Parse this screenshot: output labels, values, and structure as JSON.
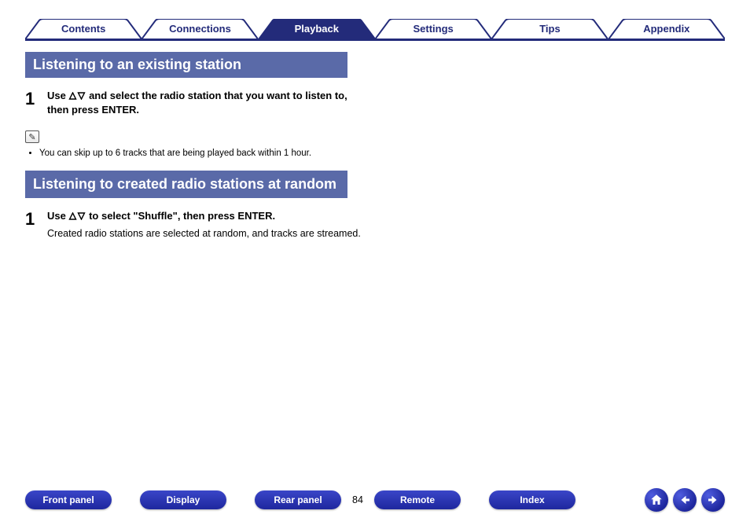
{
  "tabs": {
    "items": [
      {
        "label": "Contents",
        "active": false
      },
      {
        "label": "Connections",
        "active": false
      },
      {
        "label": "Playback",
        "active": true
      },
      {
        "label": "Settings",
        "active": false
      },
      {
        "label": "Tips",
        "active": false
      },
      {
        "label": "Appendix",
        "active": false
      }
    ]
  },
  "sections": {
    "s1": {
      "title": "Listening to an existing station",
      "step1": {
        "num": "1",
        "line_before": "Use ",
        "line_after": " and select the radio station that you want to listen to, then press ENTER."
      },
      "note": "You can skip up to 6 tracks that are being played back within 1 hour."
    },
    "s2": {
      "title": "Listening to created radio stations at random",
      "step1": {
        "num": "1",
        "line_before": "Use ",
        "line_after": " to select \"Shuffle\", then press ENTER.",
        "sub": "Created radio stations are selected at random, and tracks are streamed."
      }
    }
  },
  "footer": {
    "buttons": {
      "front_panel": "Front panel",
      "display": "Display",
      "rear_panel": "Rear panel",
      "remote": "Remote",
      "index": "Index"
    },
    "page_number": "84"
  },
  "icons": {
    "pencil": "✎"
  }
}
